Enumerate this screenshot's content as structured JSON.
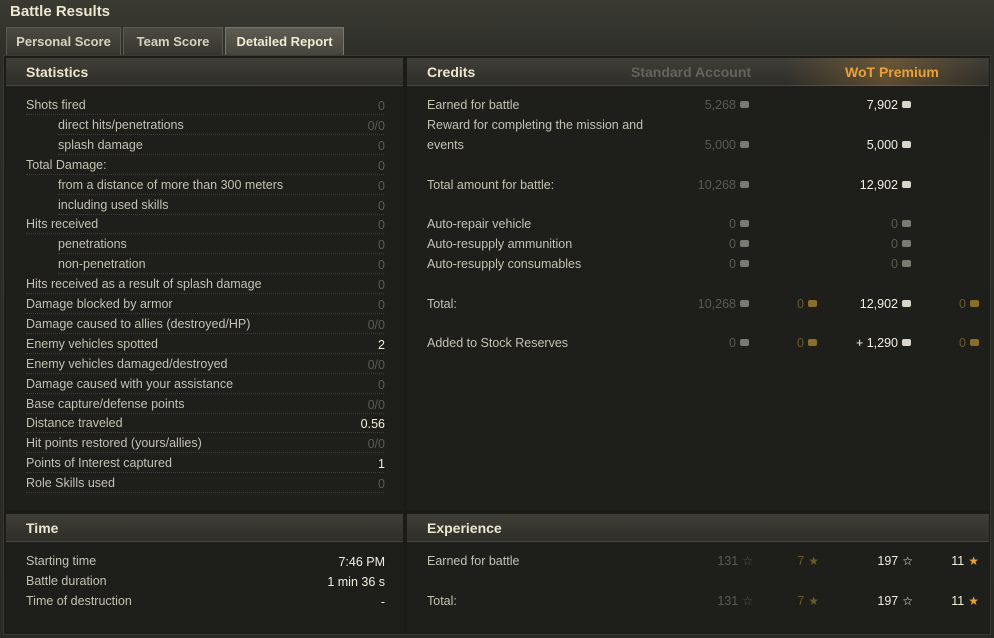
{
  "window": {
    "title": "Battle Results"
  },
  "tabs": [
    {
      "label": "Personal Score",
      "active": false
    },
    {
      "label": "Team Score",
      "active": false
    },
    {
      "label": "Detailed Report",
      "active": true
    }
  ],
  "statistics": {
    "title": "Statistics",
    "rows": [
      {
        "label": "Shots fired",
        "value": "0"
      },
      {
        "label": "direct hits/penetrations",
        "value": "0/0"
      },
      {
        "label": "splash damage",
        "value": "0"
      },
      {
        "label": "Total Damage:",
        "value": "0"
      },
      {
        "label": "from a distance of more than 300 meters",
        "value": "0"
      },
      {
        "label": "including used skills",
        "value": "0"
      },
      {
        "label": "Hits received",
        "value": "0"
      },
      {
        "label": "penetrations",
        "value": "0"
      },
      {
        "label": "non-penetration",
        "value": "0"
      },
      {
        "label": "Hits received as a result of splash damage",
        "value": "0"
      },
      {
        "label": "Damage blocked by armor",
        "value": "0"
      },
      {
        "label": "Damage caused to allies (destroyed/HP)",
        "value": "0/0"
      },
      {
        "label": "Enemy vehicles spotted",
        "value": "2"
      },
      {
        "label": "Enemy vehicles damaged/destroyed",
        "value": "0/0"
      },
      {
        "label": "Damage caused with your assistance",
        "value": "0"
      },
      {
        "label": "Base capture/defense points",
        "value": "0/0"
      },
      {
        "label": "Distance traveled",
        "value": "0.56"
      },
      {
        "label": "Hit points restored (yours/allies)",
        "value": "0/0"
      },
      {
        "label": "Points of Interest captured",
        "value": "1"
      },
      {
        "label": "Role Skills used",
        "value": "0"
      }
    ]
  },
  "credits": {
    "title": "Credits",
    "standard_header": "Standard Account",
    "premium_header": "WoT Premium",
    "rows": [
      {
        "label": "Earned for battle",
        "std": "5,268",
        "std_gold": "",
        "prem": "7,902",
        "prem_gold": ""
      },
      {
        "label": "Reward for completing the mission and",
        "label2": "events",
        "std": "5,000",
        "std_gold": "",
        "prem": "5,000",
        "prem_gold": ""
      },
      {
        "label": "Total amount for battle:",
        "std": "10,268",
        "std_gold": "",
        "prem": "12,902",
        "prem_gold": ""
      },
      {
        "label": "Auto-repair vehicle",
        "std": "0",
        "std_gold": "",
        "prem": "0",
        "prem_gold": ""
      },
      {
        "label": "Auto-resupply ammunition",
        "std": "0",
        "std_gold": "",
        "prem": "0",
        "prem_gold": ""
      },
      {
        "label": "Auto-resupply consumables",
        "std": "0",
        "std_gold": "",
        "prem": "0",
        "prem_gold": ""
      },
      {
        "label": "Total:",
        "std": "10,268",
        "std_gold": "0",
        "prem": "12,902",
        "prem_gold": "0"
      },
      {
        "label": "Added to Stock Reserves",
        "std": "0",
        "std_gold": "0",
        "prem": "+ 1,290",
        "prem_gold": "0"
      }
    ]
  },
  "time": {
    "title": "Time",
    "rows": [
      {
        "label": "Starting time",
        "value": "7:46 PM"
      },
      {
        "label": "Battle duration",
        "value": "1 min 36 s"
      },
      {
        "label": "Time of destruction",
        "value": "-"
      }
    ]
  },
  "experience": {
    "title": "Experience",
    "rows": [
      {
        "label": "Earned for battle",
        "std": "131",
        "std_free": "7",
        "prem": "197",
        "prem_free": "11"
      },
      {
        "label": "Total:",
        "std": "131",
        "std_free": "7",
        "prem": "197",
        "prem_free": "11"
      }
    ]
  },
  "colors": {
    "premium_accent": "#e8a23c",
    "free_xp_star": "#e8a23c"
  },
  "icons": {
    "credits": "credits-icon",
    "gold": "gold-icon",
    "xp": "star-icon",
    "free_xp": "free-xp-star-icon"
  }
}
